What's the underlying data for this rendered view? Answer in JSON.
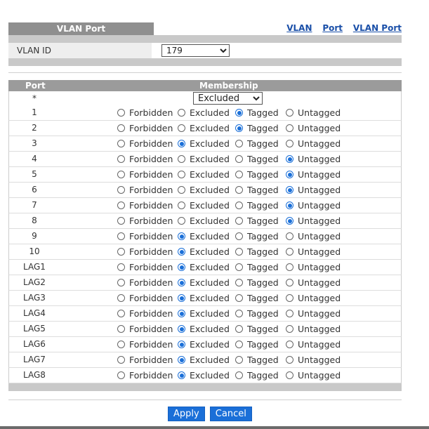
{
  "page": {
    "title": "VLAN Port",
    "nav_links": [
      "VLAN",
      "Port",
      "VLAN Port"
    ]
  },
  "vlan": {
    "label": "VLAN ID",
    "selected": "179"
  },
  "table": {
    "port_header": "Port",
    "membership_header": "Membership",
    "all_port_label": "*",
    "all_selected": "Excluded",
    "option_labels": [
      "Forbidden",
      "Excluded",
      "Tagged",
      "Untagged"
    ],
    "rows": [
      {
        "port": "1",
        "selected": "Tagged"
      },
      {
        "port": "2",
        "selected": "Tagged"
      },
      {
        "port": "3",
        "selected": "Excluded"
      },
      {
        "port": "4",
        "selected": "Untagged"
      },
      {
        "port": "5",
        "selected": "Untagged"
      },
      {
        "port": "6",
        "selected": "Untagged"
      },
      {
        "port": "7",
        "selected": "Untagged"
      },
      {
        "port": "8",
        "selected": "Untagged"
      },
      {
        "port": "9",
        "selected": "Excluded"
      },
      {
        "port": "10",
        "selected": "Excluded"
      },
      {
        "port": "LAG1",
        "selected": "Excluded"
      },
      {
        "port": "LAG2",
        "selected": "Excluded"
      },
      {
        "port": "LAG3",
        "selected": "Excluded"
      },
      {
        "port": "LAG4",
        "selected": "Excluded"
      },
      {
        "port": "LAG5",
        "selected": "Excluded"
      },
      {
        "port": "LAG6",
        "selected": "Excluded"
      },
      {
        "port": "LAG7",
        "selected": "Excluded"
      },
      {
        "port": "LAG8",
        "selected": "Excluded"
      }
    ]
  },
  "buttons": {
    "apply": "Apply",
    "cancel": "Cancel"
  },
  "colors": {
    "accent": "#1a6fd8",
    "header_bg": "#8f8f8f",
    "link": "#1a4fa8"
  }
}
